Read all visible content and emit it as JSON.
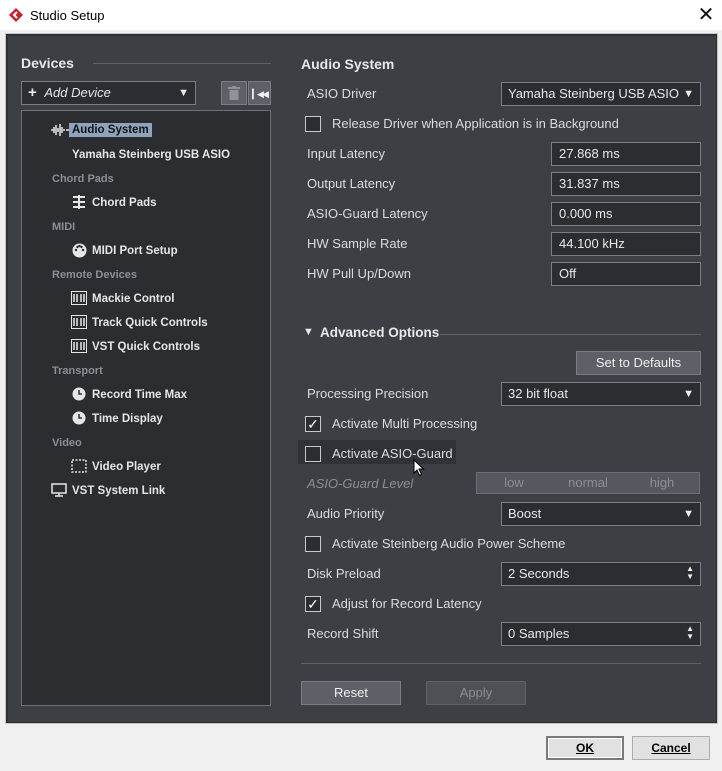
{
  "window": {
    "title": "Studio Setup",
    "close_glyph": "✕"
  },
  "left": {
    "header": "Devices",
    "add_device": "Add Device",
    "tree": {
      "audio_system": "Audio System",
      "yamaha": "Yamaha Steinberg USB ASIO",
      "cat_chord_pads": "Chord Pads",
      "chord_pads": "Chord Pads",
      "cat_midi": "MIDI",
      "midi_port_setup": "MIDI Port Setup",
      "cat_remote": "Remote Devices",
      "mackie": "Mackie Control",
      "track_qc": "Track Quick Controls",
      "vst_qc": "VST Quick Controls",
      "cat_transport": "Transport",
      "record_time_max": "Record Time Max",
      "time_display": "Time Display",
      "cat_video": "Video",
      "video_player": "Video Player",
      "vst_system_link": "VST System Link"
    }
  },
  "right": {
    "header": "Audio System",
    "asio_driver_label": "ASIO Driver",
    "asio_driver_value": "Yamaha Steinberg USB ASIO",
    "release_driver_label": "Release Driver when Application is in Background",
    "release_driver_checked": false,
    "input_latency_label": "Input Latency",
    "input_latency_value": "27.868 ms",
    "output_latency_label": "Output Latency",
    "output_latency_value": "31.837 ms",
    "asio_guard_latency_label": "ASIO-Guard Latency",
    "asio_guard_latency_value": "0.000 ms",
    "hw_sample_rate_label": "HW Sample Rate",
    "hw_sample_rate_value": "44.100 kHz",
    "hw_pull_label": "HW Pull Up/Down",
    "hw_pull_value": "Off",
    "advanced_header": "Advanced Options",
    "set_defaults": "Set to Defaults",
    "processing_precision_label": "Processing Precision",
    "processing_precision_value": "32 bit float",
    "multi_processing_label": "Activate Multi Processing",
    "multi_processing_checked": true,
    "asio_guard_label": "Activate ASIO-Guard",
    "asio_guard_checked": false,
    "asio_guard_level_label": "ASIO-Guard Level",
    "asio_guard_levels": [
      "low",
      "normal",
      "high"
    ],
    "audio_priority_label": "Audio Priority",
    "audio_priority_value": "Boost",
    "power_scheme_label": "Activate Steinberg Audio Power Scheme",
    "power_scheme_checked": false,
    "disk_preload_label": "Disk Preload",
    "disk_preload_value": "2 Seconds",
    "adjust_latency_label": "Adjust for Record Latency",
    "adjust_latency_checked": true,
    "record_shift_label": "Record Shift",
    "record_shift_value": "0 Samples",
    "reset": "Reset",
    "apply": "Apply"
  },
  "footer": {
    "ok": "OK",
    "cancel": "Cancel"
  },
  "colors": {
    "panel": "#3c3f44",
    "field": "#2b2d31",
    "selection": "#8fa3bd",
    "cubase_red": "#c8202f"
  }
}
